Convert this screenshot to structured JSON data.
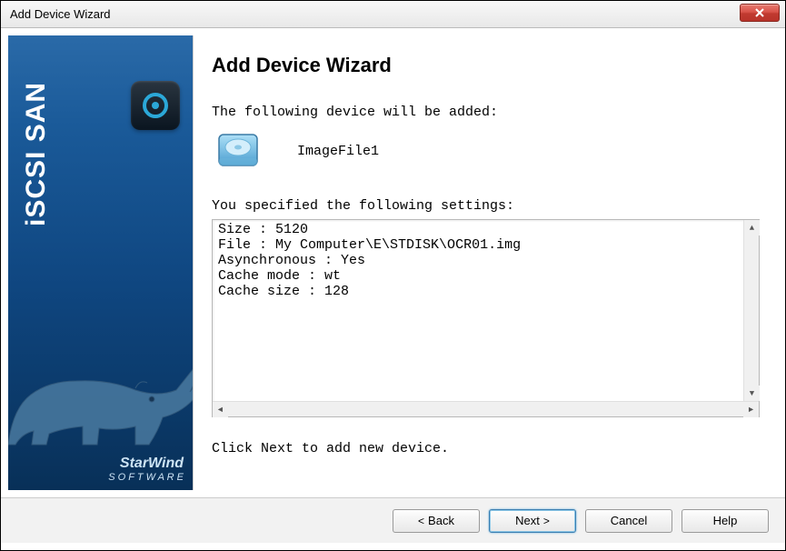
{
  "window": {
    "title": "Add Device Wizard"
  },
  "sidebar": {
    "product_name": "iSCSI SAN",
    "brand_top": "StarWind",
    "brand_bottom": "S O F T W A R E"
  },
  "main": {
    "heading": "Add Device Wizard",
    "intro": "The following device will be added:",
    "device_name": "ImageFile1",
    "settings_label": "You specified the following settings:",
    "settings": {
      "size_label": "Size",
      "size_value": "5120",
      "file_label": "File",
      "file_value": "My Computer\\E\\STDISK\\OCR01.img",
      "async_label": "Asynchronous",
      "async_value": "Yes",
      "cache_mode_label": "Cache mode",
      "cache_mode_value": "wt",
      "cache_size_label": "Cache size",
      "cache_size_value": "128"
    },
    "footer_hint": "Click Next to add new device."
  },
  "buttons": {
    "back": "Back",
    "next": "Next",
    "cancel": "Cancel",
    "help": "Help"
  }
}
